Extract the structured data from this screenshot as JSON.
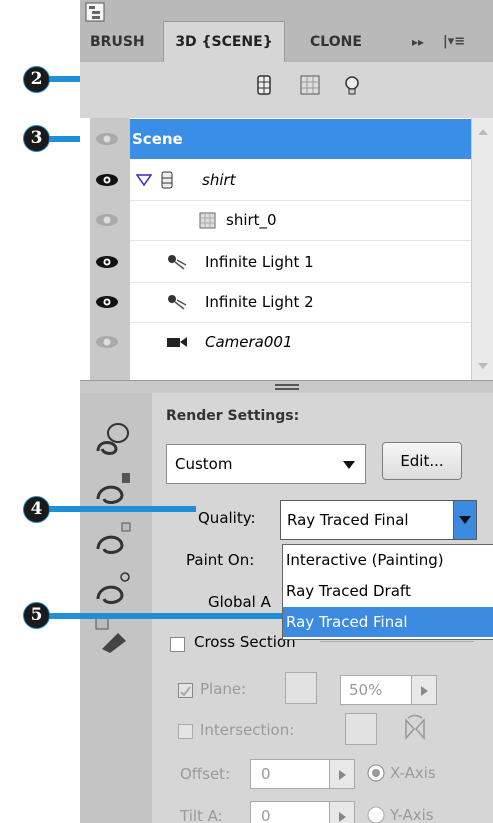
{
  "tabs": [
    {
      "label": "BRUSH"
    },
    {
      "label": "3D {SCENE}"
    },
    {
      "label": "CLONE"
    }
  ],
  "tab_more": "▸▸",
  "tab_menu": "|▾≡",
  "callouts": {
    "c2": "2",
    "c3": "3",
    "c4": "4",
    "c5": "5"
  },
  "scene_items": [
    {
      "label": "Scene"
    },
    {
      "label": "shirt"
    },
    {
      "label": "shirt_0"
    },
    {
      "label": "Infinite Light 1"
    },
    {
      "label": "Infinite Light 2"
    },
    {
      "label": "Camera001"
    }
  ],
  "render": {
    "settings_label": "Render Settings:",
    "preset_value": "Custom",
    "edit_label": "Edit...",
    "quality_label": "Quality:",
    "quality_value": "Ray Traced Final",
    "paint_on_label": "Paint On:",
    "global_label": "Global A",
    "quality_options": [
      "Interactive (Painting)",
      "Ray Traced Draft",
      "Ray Traced Final"
    ]
  },
  "cross_section": {
    "label": "Cross Section",
    "plane_label": "Plane:",
    "plane_opacity": "50%",
    "intersection_label": "Intersection:",
    "offset_label": "Offset:",
    "offset_value": "0",
    "tilt_label": "Tilt A:",
    "tilt_value": "0",
    "x_axis_label": "X-Axis",
    "y_axis_label": "Y-Axis"
  },
  "colors": {
    "accent": "#1f8fd6",
    "selection": "#3a8ee6",
    "highlight": "#3c8be0"
  }
}
